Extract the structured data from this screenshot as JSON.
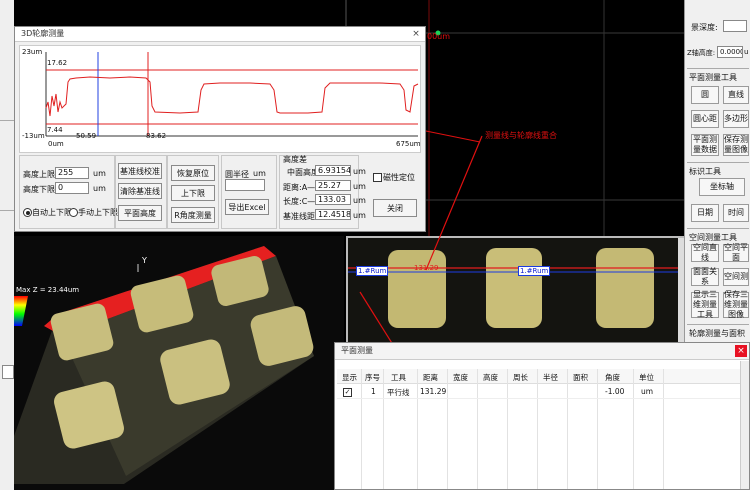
{
  "right_panel": {
    "depth_label": "景深度:",
    "z_height_label": "Z轴高度:",
    "z_height_value": "0.0000",
    "z_height_unit": "u",
    "plane_tools_title": "平面测量工具",
    "plane_buttons": [
      "圆",
      "直线",
      "圆心距",
      "多边形",
      "平面测量数据",
      "保存测量图像"
    ],
    "mark_tools_title": "标识工具",
    "mark_buttons": [
      "坐标轴",
      "日期",
      "时间"
    ],
    "space_tools_title": "空间测量工具",
    "space_buttons": [
      "空间直线",
      "空间平面",
      "面面关系",
      "空间测",
      "显示三维测量工具",
      "保存三维测量图像"
    ],
    "bottom_title": "轮廓测量与面积"
  },
  "dialog3d": {
    "title": "3D轮廓测量",
    "close": "×",
    "chart": {
      "y_top": "23um",
      "y_bottom": "-13um",
      "ref_top_value": "17.62",
      "ref_bottom_value": "7.44",
      "x_start": "0um",
      "x_marker1": "50.59",
      "x_marker2": "83.62",
      "x_end": "675um"
    },
    "upper_limit_label": "高度上限",
    "upper_limit_value": "255",
    "lower_limit_label": "高度下限",
    "lower_limit_value": "0",
    "unit_um": "um",
    "auto_limit": "自动上下限",
    "manual_limit": "手动上下限",
    "btn_calibrate": "基准线校准",
    "btn_clear": "清除基准线",
    "btn_plane_height": "平面高度",
    "btn_restore": "恢复原位",
    "btn_up_down": "上下限",
    "btn_r_angle": "R角度测量",
    "radius_label": "圆半径",
    "radius_unit": "um",
    "btn_export": "导出Excel",
    "height_diff_title": "高度差",
    "mid_height_label": "中面高度",
    "mid_height_value": "6.931549",
    "dist_ab_label": "距离:A—B",
    "dist_ab_value": "25.27",
    "len_cd_label": "长度:C—D",
    "len_cd_value": "133.03",
    "base_dist_label": "基准线距离",
    "base_dist_value": "12.451821",
    "magnetic_label": "磁性定位",
    "btn_close": "关闭"
  },
  "annotation": "测量线与轮廓线重合",
  "view3d": {
    "max_z": "Max Z = 23.44um",
    "axis_y": "Y"
  },
  "view2d": {
    "label_left": "1.#Rum",
    "label_right": "1.#Rum",
    "readout": "131.29"
  },
  "top_marker": "00um",
  "dialog2d": {
    "title": "平面测量",
    "close": "×",
    "headers": [
      "显示",
      "序号",
      "工具",
      "距离",
      "宽度",
      "高度",
      "周长",
      "半径",
      "面积",
      "角度",
      "单位"
    ],
    "row": {
      "index": "1",
      "tool": "平行线",
      "distance": "131.29",
      "angle": "-1.00",
      "unit": "um"
    }
  },
  "colors": {
    "chart_red": "#e02020",
    "chart_blue": "#2040e0",
    "accent_red": "#e01010"
  }
}
